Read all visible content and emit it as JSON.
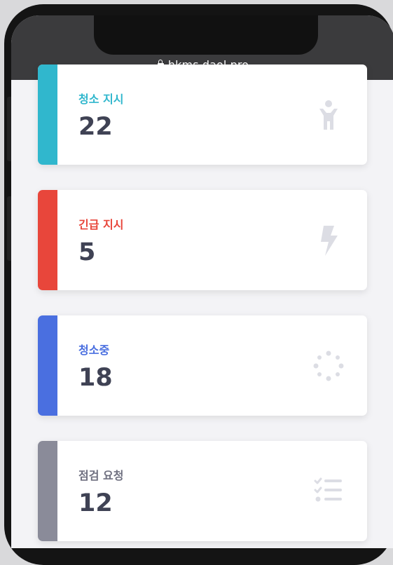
{
  "browser": {
    "url": "hkms.daol.pro",
    "lock_icon": "lock-icon"
  },
  "cards": [
    {
      "label": "청소 지시",
      "value": "22",
      "color": "#30b7cd",
      "icon": "user-icon"
    },
    {
      "label": "긴급 지시",
      "value": "5",
      "color": "#e8463b",
      "icon": "bolt-icon"
    },
    {
      "label": "청소중",
      "value": "18",
      "color": "#4a6fe0",
      "icon": "spinner-icon"
    },
    {
      "label": "점검 요청",
      "value": "12",
      "color": "#8a8b99",
      "icon": "tasks-icon"
    }
  ]
}
